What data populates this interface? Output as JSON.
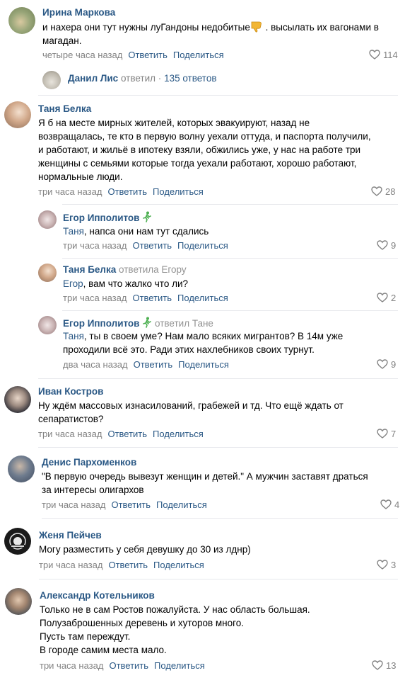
{
  "common": {
    "reply_label": "Ответить",
    "share_label": "Поделиться"
  },
  "comments": [
    {
      "author": "Ирина Маркова",
      "lines": [
        "и нахера они тут нужны луГандоны недобитые",
        " . высылать их вагонами в",
        "магадан."
      ],
      "time": "четыре часа назад",
      "likes": "114"
    },
    {
      "author": "Таня Белка",
      "lines": [
        "Я б на месте мирных жителей, которых эвакуируют, назад не",
        "возвращалась, те кто в первую волну уехали оттуда, и паспорта получили,",
        "и работают, и жильё в ипотеку взяли, обжились уже, у нас на работе три",
        "женщины с семьями которые тогда уехали работают, хорошо работают,",
        "нормальные люди."
      ],
      "time": "три часа назад",
      "likes": "28"
    },
    {
      "author": "Егор Ипполитов",
      "addressee": "Таня",
      "lines": [
        ", напса они нам тут сдались"
      ],
      "time": "три часа назад",
      "likes": "9"
    },
    {
      "author": "Таня Белка",
      "replied_to": "ответила Егору",
      "addressee": "Егор",
      "lines": [
        ", вам что жалко что ли?"
      ],
      "time": "три часа назад",
      "likes": "2"
    },
    {
      "author": "Егор Ипполитов",
      "replied_to": "ответил Тане",
      "addressee": "Таня",
      "lines": [
        ", ты в своем уме? Нам мало всяких мигрантов? В 14м уже",
        "проходили всё это. Ради этих нахлебников своих турнут."
      ],
      "time": "два часа назад",
      "likes": "9"
    },
    {
      "author": "Иван Костров",
      "lines": [
        "Ну ждём массовых изнасилований, грабежей и тд. Что ещё ждать от",
        "сепаратистов?"
      ],
      "time": "три часа назад",
      "likes": "7"
    },
    {
      "author": "Денис Пархоменков",
      "lines": [
        "\"В первую очередь вывезут женщин и детей.\" А мужчин заставят драться",
        "за интересы олигархов"
      ],
      "time": "три часа назад",
      "likes": "4"
    },
    {
      "author": "Женя Пейчев",
      "lines": [
        "Могу разместить у себя девушку до 30 из лднр)"
      ],
      "time": "три часа назад",
      "likes": "3"
    },
    {
      "author": "Александр Котельников",
      "lines": [
        "Только не в сам Ростов пожалуйста. У нас область большая.",
        "Полузаброшенных деревень и хуторов много.",
        "Пусть там переждут.",
        "В городе самим места мало."
      ],
      "time": "три часа назад",
      "likes": "13"
    }
  ],
  "thread_summary": {
    "name": "Данил Лис",
    "verb": "ответил",
    "dot": "·",
    "count": "135 ответов"
  },
  "colors": {
    "link": "#2a5885",
    "meta": "#828282",
    "separator": "#e7e8ec",
    "runner_icon": "#4caf50"
  }
}
